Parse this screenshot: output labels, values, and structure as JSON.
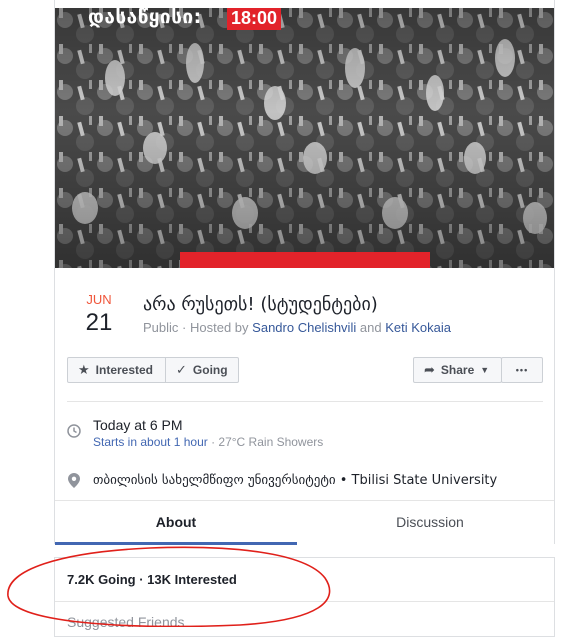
{
  "cover": {
    "top_text": "დასაწყისი:",
    "time_badge": "18:00"
  },
  "date": {
    "month": "JUN",
    "day": "21"
  },
  "event": {
    "title": "არა რუსეთს! (სტუდენტები)",
    "privacy": "Public",
    "hosted_by": "Hosted by",
    "host1": "Sandro Chelishvili",
    "and": "and",
    "host2": "Keti Kokaia"
  },
  "actions": {
    "interested_label": "Interested",
    "going_label": "Going",
    "share_label": "Share",
    "more_label": "•••"
  },
  "time_info": {
    "main": "Today at 6 PM",
    "starts": "Starts in about 1 hour",
    "weather": " · 27°C Rain Showers"
  },
  "location": {
    "main": "თბილისის სახელმწიფო უნივერსიტეტი • Tbilisi State University"
  },
  "tabs": [
    {
      "label": "About"
    },
    {
      "label": "Discussion"
    }
  ],
  "stats": {
    "summary": "7.2K Going · 13K Interested",
    "suggested_label": "Suggested Friends"
  },
  "colors": {
    "accent": "#4267b2",
    "link": "#365899",
    "date_red": "#f0563b",
    "annotation_red": "#e0201a",
    "badge_red": "#e2232a"
  }
}
